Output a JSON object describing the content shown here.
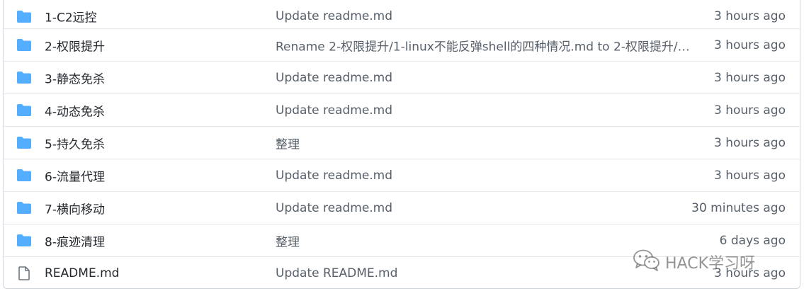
{
  "colors": {
    "folder": "#54aeff",
    "file_icon": "#6e7781",
    "border": "#d0d7de"
  },
  "rows": [
    {
      "type": "folder",
      "icon": "folder-icon",
      "name": "1-C2远控",
      "message": "Update readme.md",
      "age": "3 hours ago"
    },
    {
      "type": "folder",
      "icon": "folder-icon",
      "name": "2-权限提升",
      "message": "Rename 2-权限提升/1-linux不能反弹shell的四种情况.md to 2-权限提升/2...",
      "age": "3 hours ago"
    },
    {
      "type": "folder",
      "icon": "folder-icon",
      "name": "3-静态免杀",
      "message": "Update readme.md",
      "age": "3 hours ago"
    },
    {
      "type": "folder",
      "icon": "folder-icon",
      "name": "4-动态免杀",
      "message": "Update readme.md",
      "age": "3 hours ago"
    },
    {
      "type": "folder",
      "icon": "folder-icon",
      "name": "5-持久免杀",
      "message": "整理",
      "age": "3 hours ago"
    },
    {
      "type": "folder",
      "icon": "folder-icon",
      "name": "6-流量代理",
      "message": "Update readme.md",
      "age": "3 hours ago"
    },
    {
      "type": "folder",
      "icon": "folder-icon",
      "name": "7-横向移动",
      "message": "Update readme.md",
      "age": "30 minutes ago"
    },
    {
      "type": "folder",
      "icon": "folder-icon",
      "name": "8-痕迹清理",
      "message": "整理",
      "age": "6 days ago"
    },
    {
      "type": "file",
      "icon": "file-icon",
      "name": "README.md",
      "message": "Update README.md",
      "age": "3 hours ago"
    }
  ],
  "watermark": {
    "icon": "wechat-icon",
    "text": "HACK学习呀"
  }
}
